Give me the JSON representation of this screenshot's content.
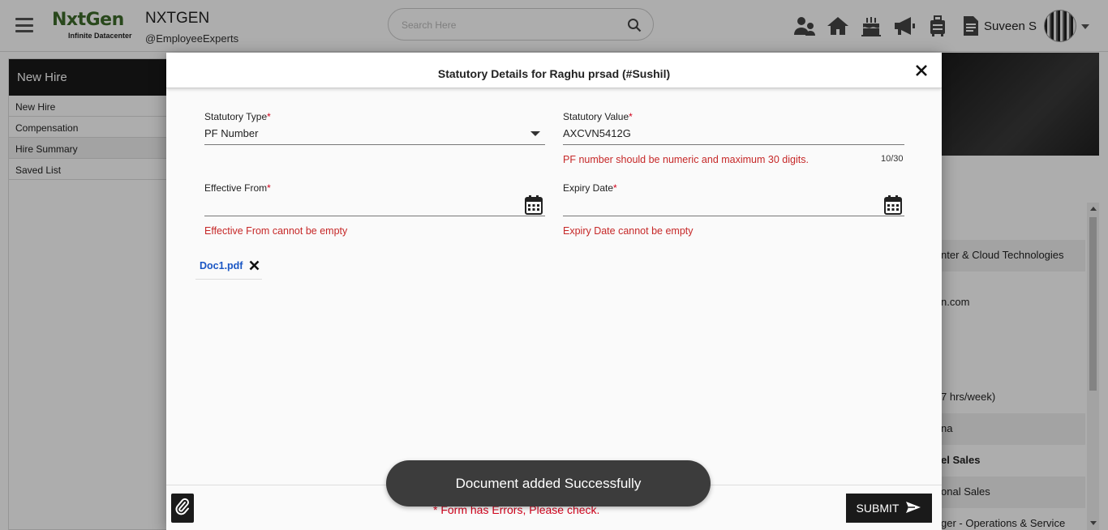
{
  "header": {
    "logo_main": "NxtGen",
    "logo_sub": "Infinite Datacenter",
    "org_name": "NXTGEN",
    "org_handle": "@EmployeeExperts",
    "search_placeholder": "Search Here",
    "user_name": "Suveen S",
    "icons": [
      "team-icon",
      "home-icon",
      "cake-icon",
      "megaphone-icon",
      "luggage-icon",
      "document-icon"
    ]
  },
  "sidebar": {
    "title": "New Hire",
    "items": [
      {
        "label": "New Hire"
      },
      {
        "label": "Compensation"
      },
      {
        "label": "Hire Summary"
      },
      {
        "label": "Saved List"
      }
    ]
  },
  "background_rows": [
    {
      "text": "nter & Cloud Technologies"
    },
    {
      "text": "n.com"
    },
    {
      "text": "7 hrs/week)"
    },
    {
      "text": "na"
    },
    {
      "text": "el Sales"
    },
    {
      "text": "onal Sales"
    },
    {
      "text": "ger - Operations & Service"
    }
  ],
  "modal": {
    "title": "Statutory Details for Raghu prsad (#Sushil)",
    "required_mark": "*",
    "statutory_type": {
      "label": "Statutory Type",
      "value": "PF Number"
    },
    "statutory_value": {
      "label": "Statutory Value",
      "value": "AXCVN5412G",
      "error": "PF number should be numeric and maximum 30 digits.",
      "counter": "10/30"
    },
    "effective_from": {
      "label": "Effective From",
      "value": "",
      "error": "Effective From cannot be empty"
    },
    "expiry_date": {
      "label": "Expiry Date",
      "value": "",
      "error": "Expiry Date cannot be empty"
    },
    "document": {
      "name": "Doc1.pdf"
    },
    "form_error": "* Form has Errors, Please check.",
    "submit_label": "SUBMIT"
  },
  "toast": {
    "message": "Document added Successfully"
  },
  "colors": {
    "error": "#c62828",
    "link": "#1a56c4",
    "dark_button": "#1a1a1a",
    "toast_bg": "#3c3c3c",
    "brand_green": "#3d6b2a"
  }
}
